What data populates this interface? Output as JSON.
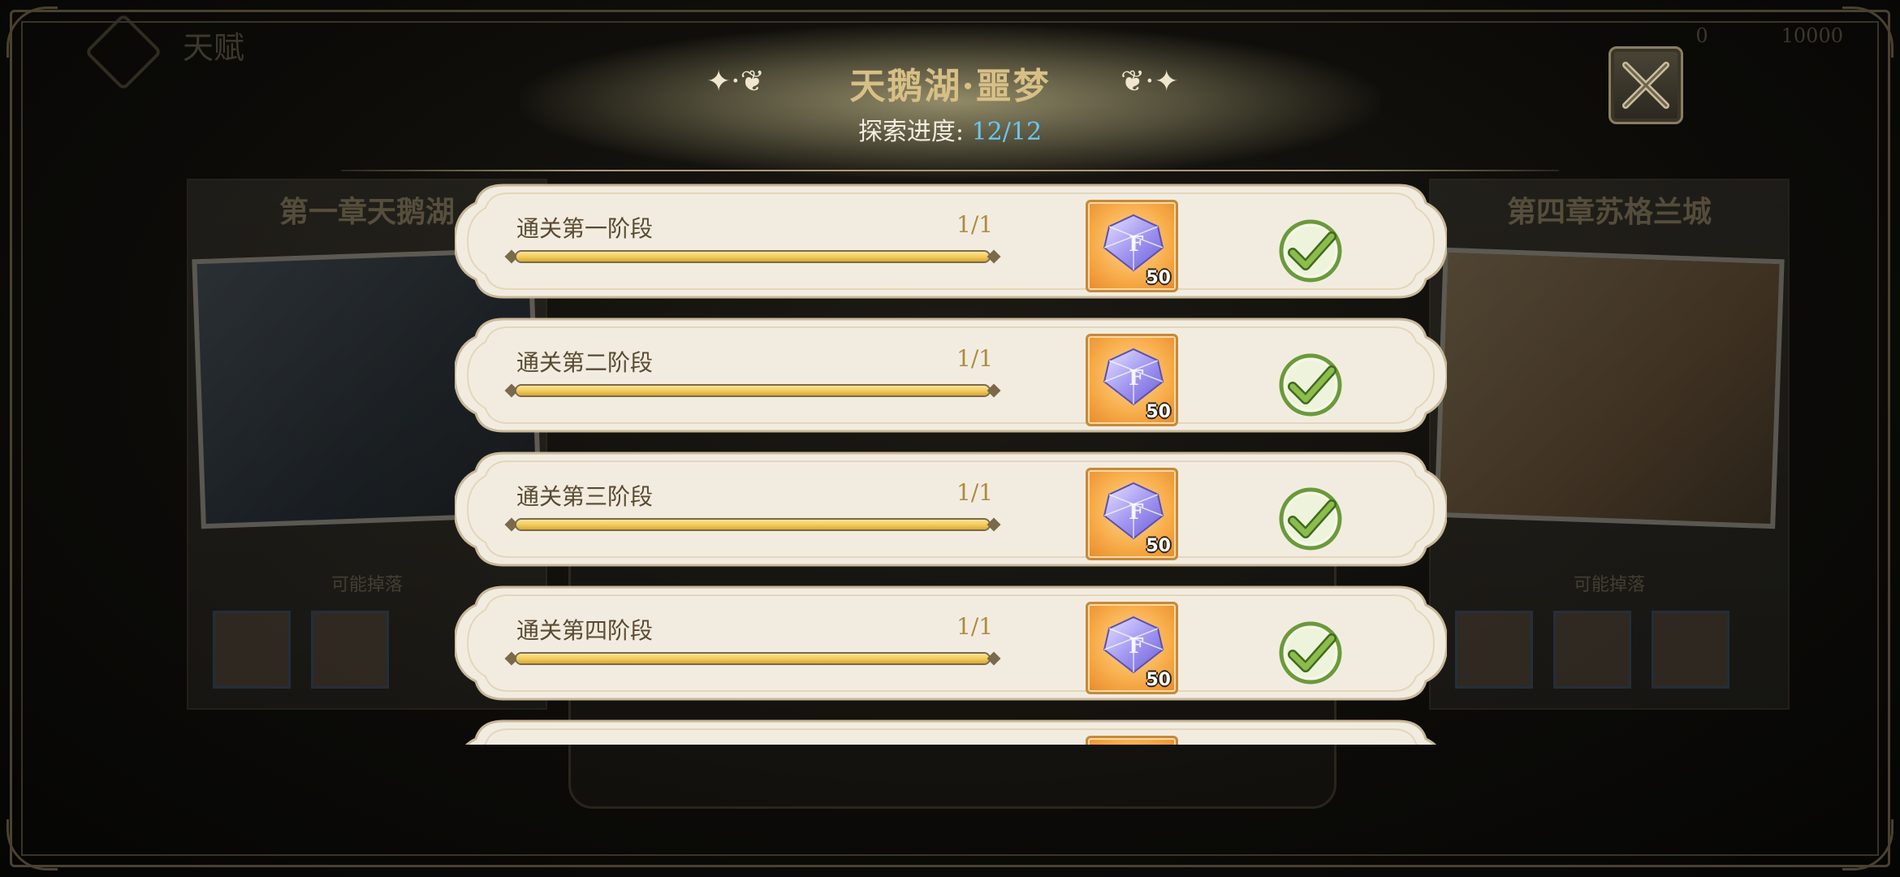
{
  "header": {
    "title": "天鹅湖·噩梦",
    "progress_label": "探索进度:",
    "progress_value": "12/12"
  },
  "background": {
    "top_title": "天赋",
    "left_chapter": {
      "title": "第一章天鹅湖",
      "drop_label": "可能掉落"
    },
    "right_chapter": {
      "title": "第四章苏格兰城",
      "drop_label": "可能掉落"
    },
    "top_right_values": [
      "0",
      "10000"
    ]
  },
  "tasks": [
    {
      "label": "通关第一阶段",
      "count": "1/1",
      "progress": 1.0,
      "reward_qty": "50",
      "completed": true
    },
    {
      "label": "通关第二阶段",
      "count": "1/1",
      "progress": 1.0,
      "reward_qty": "50",
      "completed": true
    },
    {
      "label": "通关第三阶段",
      "count": "1/1",
      "progress": 1.0,
      "reward_qty": "50",
      "completed": true
    },
    {
      "label": "通关第四阶段",
      "count": "1/1",
      "progress": 1.0,
      "reward_qty": "50",
      "completed": true
    }
  ],
  "icons": {
    "close": "close-icon",
    "reward": "diamond-gem-icon",
    "completed": "checkmark-icon"
  },
  "colors": {
    "title_gold": "#d7bf86",
    "progress_blue": "#6bc6f0",
    "card_bg": "#f2ece0",
    "bar_fill": "#f1c956",
    "check_green": "#6a9a3a",
    "reward_orange": "#f7ab48"
  }
}
